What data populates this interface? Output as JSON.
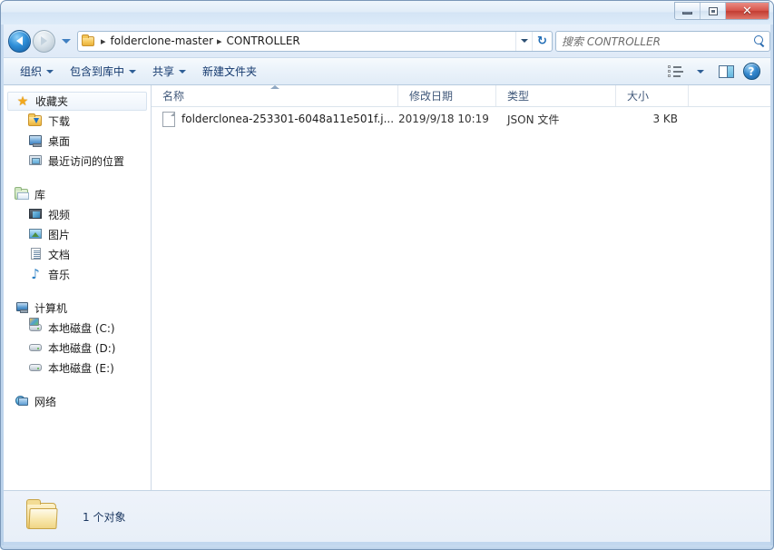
{
  "window": {
    "controls": {
      "minimize_label": "−",
      "restore_label": "",
      "close_label": "✕"
    }
  },
  "navigation": {
    "back_tooltip": "后退",
    "forward_tooltip": "前进",
    "history_tooltip": "最近浏览的位置",
    "breadcrumbs": [
      {
        "label": "folderclone-master"
      },
      {
        "label": "CONTROLLER"
      }
    ],
    "refresh_label": "↻"
  },
  "search": {
    "placeholder": "搜索 CONTROLLER"
  },
  "toolbar": {
    "items": [
      {
        "label": "组织",
        "has_caret": true
      },
      {
        "label": "包含到库中",
        "has_caret": true
      },
      {
        "label": "共享",
        "has_caret": true
      },
      {
        "label": "新建文件夹",
        "has_caret": false
      }
    ],
    "view_icon": "list-view-icon",
    "preview_icon": "preview-pane-icon",
    "help_icon": "help-icon",
    "help_label": "?"
  },
  "sidebar": {
    "groups": [
      {
        "header": {
          "label": "收藏夹",
          "icon": "star-icon"
        },
        "items": [
          {
            "label": "下载",
            "icon": "download-folder-icon"
          },
          {
            "label": "桌面",
            "icon": "desktop-icon"
          },
          {
            "label": "最近访问的位置",
            "icon": "recent-places-icon"
          }
        ]
      },
      {
        "header": {
          "label": "库",
          "icon": "library-icon"
        },
        "items": [
          {
            "label": "视频",
            "icon": "video-icon"
          },
          {
            "label": "图片",
            "icon": "picture-icon"
          },
          {
            "label": "文档",
            "icon": "document-icon"
          },
          {
            "label": "音乐",
            "icon": "music-icon"
          }
        ]
      },
      {
        "header": {
          "label": "计算机",
          "icon": "computer-icon"
        },
        "items": [
          {
            "label": "本地磁盘 (C:)",
            "icon": "system-drive-icon"
          },
          {
            "label": "本地磁盘 (D:)",
            "icon": "drive-icon"
          },
          {
            "label": "本地磁盘 (E:)",
            "icon": "drive-icon"
          }
        ]
      },
      {
        "header": {
          "label": "网络",
          "icon": "network-icon"
        },
        "items": []
      }
    ]
  },
  "file_list": {
    "columns": [
      {
        "label": "名称",
        "sorted": true
      },
      {
        "label": "修改日期",
        "sorted": false
      },
      {
        "label": "类型",
        "sorted": false
      },
      {
        "label": "大小",
        "sorted": false
      }
    ],
    "rows": [
      {
        "name": "folderclonea-253301-6048a11e501f.j...",
        "date": "2019/9/18 10:19",
        "type": "JSON 文件",
        "size": "3 KB",
        "icon": "generic-file-icon"
      }
    ]
  },
  "status_bar": {
    "text": "1 个对象",
    "icon": "folder-icon"
  },
  "colors": {
    "accent": "#1f6cb5",
    "close_button": "#c23c32",
    "frame": "#c2d7ee",
    "column_header_text": "#40587a",
    "status_text": "#19355f"
  }
}
